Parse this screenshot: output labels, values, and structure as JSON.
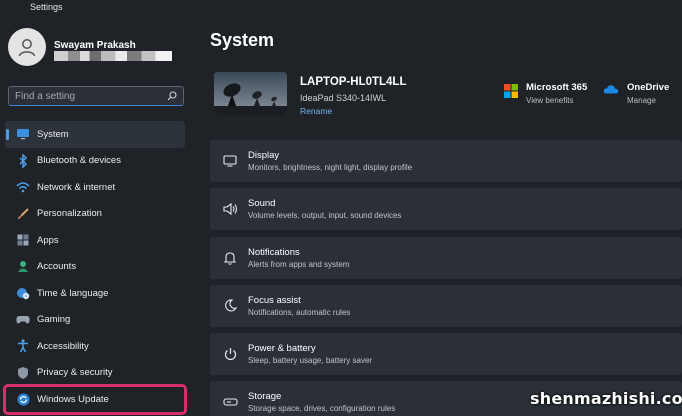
{
  "window": {
    "title": "Settings"
  },
  "user": {
    "name": "Swayam Prakash"
  },
  "search": {
    "placeholder": "Find a setting"
  },
  "sidebar": {
    "items": [
      {
        "label": "System",
        "icon": "monitor-icon",
        "active": true
      },
      {
        "label": "Bluetooth & devices",
        "icon": "bluetooth-icon"
      },
      {
        "label": "Network & internet",
        "icon": "wifi-icon"
      },
      {
        "label": "Personalization",
        "icon": "brush-icon"
      },
      {
        "label": "Apps",
        "icon": "apps-icon"
      },
      {
        "label": "Accounts",
        "icon": "person-icon"
      },
      {
        "label": "Time & language",
        "icon": "globe-clock-icon"
      },
      {
        "label": "Gaming",
        "icon": "gamepad-icon"
      },
      {
        "label": "Accessibility",
        "icon": "accessibility-icon"
      },
      {
        "label": "Privacy & security",
        "icon": "shield-icon"
      },
      {
        "label": "Windows Update",
        "icon": "windows-update-icon",
        "highlighted": true
      }
    ]
  },
  "main": {
    "title": "System",
    "device": {
      "name": "LAPTOP-HL0TL4LL",
      "model": "IdeaPad S340-14IWL",
      "rename_label": "Rename"
    },
    "services": [
      {
        "title": "Microsoft 365",
        "subtitle": "View benefits",
        "icon": "microsoft-365-icon"
      },
      {
        "title": "OneDrive",
        "subtitle": "Manage",
        "icon": "onedrive-icon"
      }
    ],
    "settings": [
      {
        "title": "Display",
        "subtitle": "Monitors, brightness, night light, display profile",
        "icon": "display-icon"
      },
      {
        "title": "Sound",
        "subtitle": "Volume levels, output, input, sound devices",
        "icon": "speaker-icon"
      },
      {
        "title": "Notifications",
        "subtitle": "Alerts from apps and system",
        "icon": "bell-icon"
      },
      {
        "title": "Focus assist",
        "subtitle": "Notifications, automatic rules",
        "icon": "moon-icon"
      },
      {
        "title": "Power & battery",
        "subtitle": "Sleep, battery usage, battery saver",
        "icon": "power-icon"
      },
      {
        "title": "Storage",
        "subtitle": "Storage space, drives, configuration rules",
        "icon": "storage-icon"
      }
    ]
  },
  "watermark": "shenmazhishi.com",
  "colors": {
    "background": "#1f2327",
    "card": "#2b3038",
    "accent": "#4c9ce8",
    "highlight_box": "#d72f6d"
  }
}
